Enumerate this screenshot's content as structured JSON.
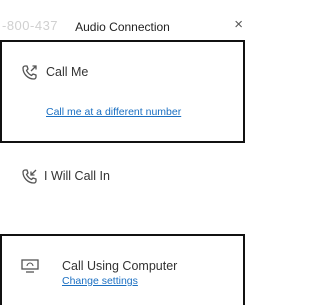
{
  "window": {
    "background_text": "-800-437",
    "title": "Audio Connection",
    "close_glyph": "×"
  },
  "options": [
    {
      "label": "Call Me",
      "icon": "phone-outgoing-icon",
      "link": "Call me at a different number",
      "selected": true
    },
    {
      "label": "I Will Call In",
      "icon": "phone-incoming-icon",
      "selected": false
    },
    {
      "label": "Call Using Computer",
      "icon": "computer-audio-icon",
      "link": "Change settings",
      "selected": true
    }
  ],
  "colors": {
    "link": "#1a6fc2",
    "border": "#111111",
    "text": "#333333"
  }
}
